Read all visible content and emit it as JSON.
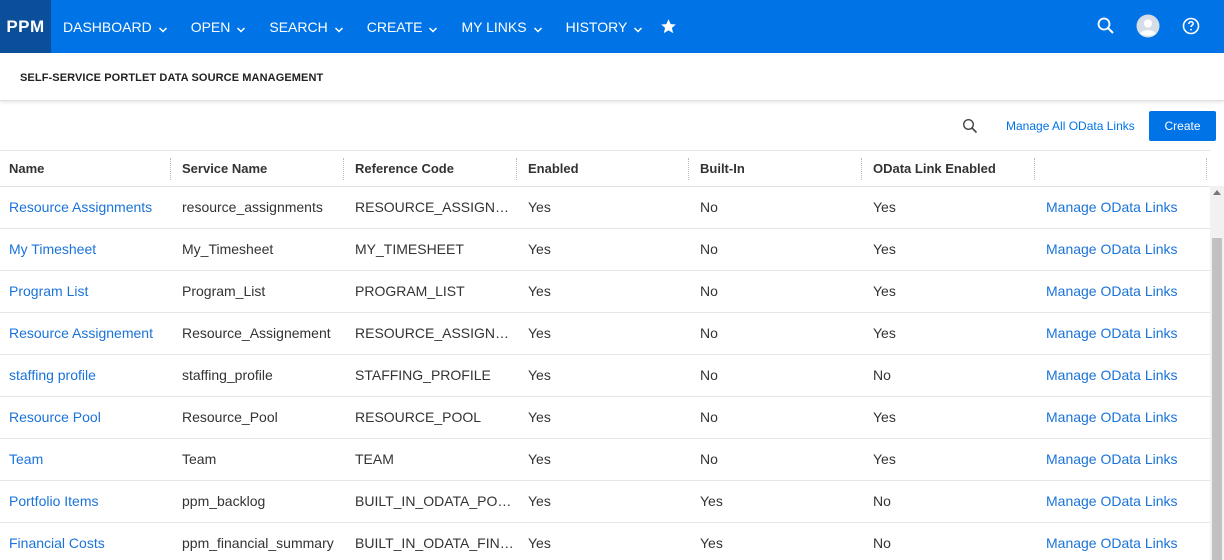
{
  "nav": {
    "logo": "PPM",
    "items": [
      {
        "label": "DASHBOARD"
      },
      {
        "label": "OPEN"
      },
      {
        "label": "SEARCH"
      },
      {
        "label": "CREATE"
      },
      {
        "label": "MY LINKS"
      },
      {
        "label": "HISTORY"
      }
    ],
    "star_icon": "star-icon",
    "right_icons": [
      "search-icon",
      "user-avatar-icon",
      "help-icon"
    ],
    "colors": {
      "bar": "#0073e7",
      "logo_bg": "#0b4f9a"
    }
  },
  "page": {
    "title": "SELF-SERVICE PORTLET DATA SOURCE MANAGEMENT"
  },
  "toolbar": {
    "search_icon": "search-icon",
    "manage_all_label": "Manage All OData Links",
    "create_label": "Create"
  },
  "table": {
    "columns": [
      "Name",
      "Service Name",
      "Reference Code",
      "Enabled",
      "Built-In",
      "OData Link Enabled",
      ""
    ],
    "rows": [
      {
        "name": "Resource Assignments",
        "service": "resource_assignments",
        "code": "RESOURCE_ASSIGNMENTS",
        "enabled": "Yes",
        "builtin": "No",
        "odata": "Yes",
        "action": "Manage OData Links"
      },
      {
        "name": "My Timesheet",
        "service": "My_Timesheet",
        "code": "MY_TIMESHEET",
        "enabled": "Yes",
        "builtin": "No",
        "odata": "Yes",
        "action": "Manage OData Links"
      },
      {
        "name": "Program List",
        "service": "Program_List",
        "code": "PROGRAM_LIST",
        "enabled": "Yes",
        "builtin": "No",
        "odata": "Yes",
        "action": "Manage OData Links"
      },
      {
        "name": "Resource Assignement",
        "service": "Resource_Assignement",
        "code": "RESOURCE_ASSIGNEMENT",
        "enabled": "Yes",
        "builtin": "No",
        "odata": "Yes",
        "action": "Manage OData Links"
      },
      {
        "name": "staffing profile",
        "service": "staffing_profile",
        "code": "STAFFING_PROFILE",
        "enabled": "Yes",
        "builtin": "No",
        "odata": "No",
        "action": "Manage OData Links"
      },
      {
        "name": "Resource Pool",
        "service": "Resource_Pool",
        "code": "RESOURCE_POOL",
        "enabled": "Yes",
        "builtin": "No",
        "odata": "Yes",
        "action": "Manage OData Links"
      },
      {
        "name": "Team",
        "service": "Team",
        "code": "TEAM",
        "enabled": "Yes",
        "builtin": "No",
        "odata": "Yes",
        "action": "Manage OData Links"
      },
      {
        "name": "Portfolio Items",
        "service": "ppm_backlog",
        "code": "BUILT_IN_ODATA_PORTFOLIO",
        "enabled": "Yes",
        "builtin": "Yes",
        "odata": "No",
        "action": "Manage OData Links"
      },
      {
        "name": "Financial Costs",
        "service": "ppm_financial_summary",
        "code": "BUILT_IN_ODATA_FINANCIAL",
        "enabled": "Yes",
        "builtin": "Yes",
        "odata": "No",
        "action": "Manage OData Links"
      }
    ]
  }
}
